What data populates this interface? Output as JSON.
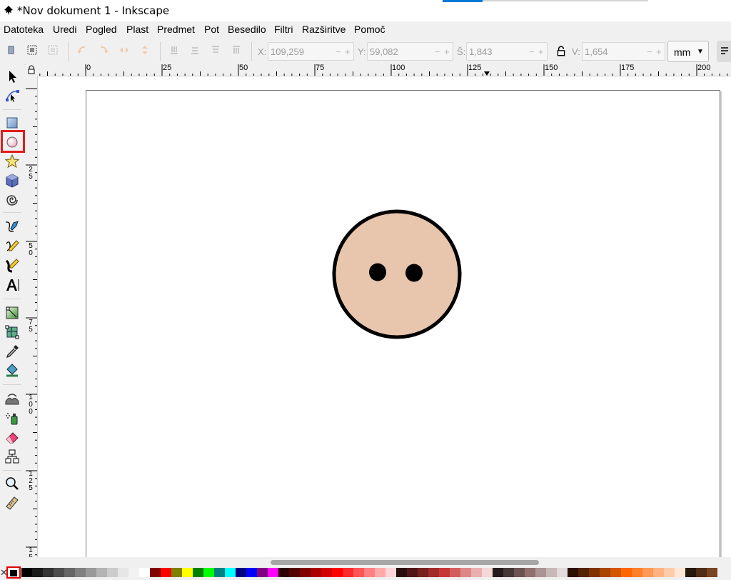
{
  "window": {
    "title": "*Nov dokument 1 - Inkscape"
  },
  "menu": [
    "Datoteka",
    "Uredi",
    "Pogled",
    "Plast",
    "Predmet",
    "Pot",
    "Besedilo",
    "Filtri",
    "Razširitve",
    "Pomoč"
  ],
  "toolbar": {
    "x": {
      "label": "X:",
      "value": "109,259"
    },
    "y": {
      "label": "Y:",
      "value": "59,082"
    },
    "w": {
      "label": "Š:",
      "value": "1,843"
    },
    "h": {
      "label": "V:",
      "value": "1,654"
    },
    "unit": "mm",
    "plus": "+",
    "minus": "−"
  },
  "tools": [
    "select-icon",
    "node-icon",
    "rectangle-icon",
    "ellipse-icon",
    "star-icon",
    "box3d-icon",
    "spiral-icon",
    "pen-icon",
    "pencil-icon",
    "calligraphy-icon",
    "text-icon",
    "gradient-icon",
    "mesh-icon",
    "dropper-icon",
    "paint-bucket-icon",
    "tweak-icon",
    "spray-icon",
    "eraser-icon",
    "connector-icon",
    "zoom-icon",
    "measure-icon"
  ],
  "active_tool": "ellipse-icon",
  "hruler_labels": [
    "0",
    "25",
    "50",
    "75",
    "100",
    "125",
    "150",
    "175",
    "200"
  ],
  "vruler_labels": [
    [
      "2",
      "5"
    ],
    [
      "5",
      "0"
    ],
    [
      "7",
      "5"
    ],
    [
      "1",
      "0",
      "0"
    ],
    [
      "1",
      "2",
      "5"
    ],
    [
      "1",
      "5"
    ]
  ],
  "drawing": {
    "face_fill": "#e8c5ad",
    "stroke": "#000000",
    "eye_fill": "#000000"
  },
  "palette": [
    "#000000",
    "#1a1a1a",
    "#333333",
    "#4d4d4d",
    "#666666",
    "#808080",
    "#999999",
    "#b3b3b3",
    "#cccccc",
    "#e6e6e6",
    "#f2f2f2",
    "#ffffff",
    "#800000",
    "#ff0000",
    "#808000",
    "#ffff00",
    "#008000",
    "#00ff00",
    "#008080",
    "#00ffff",
    "#000080",
    "#0000ff",
    "#800080",
    "#ff00ff",
    "#2b0000",
    "#550000",
    "#800000",
    "#aa0000",
    "#d40000",
    "#ff0000",
    "#ff2a2a",
    "#ff5555",
    "#ff8080",
    "#ffaaaa",
    "#ffd5d5",
    "#280b0b",
    "#501616",
    "#782121",
    "#a02c2c",
    "#c83737",
    "#d35f5f",
    "#de8787",
    "#e9afaf",
    "#f4d7d7",
    "#241c1c",
    "#483737",
    "#6c5353",
    "#916f6f",
    "#ac9393",
    "#c8b7b7",
    "#e3dbdb",
    "#2b1100",
    "#552200",
    "#803300",
    "#aa4400",
    "#d45500",
    "#ff6600",
    "#ff7f2a",
    "#ff9955",
    "#ffb380",
    "#ffccaa",
    "#ffe6d5",
    "#28170b",
    "#502d16",
    "#784421"
  ],
  "current_fill": "#000000"
}
